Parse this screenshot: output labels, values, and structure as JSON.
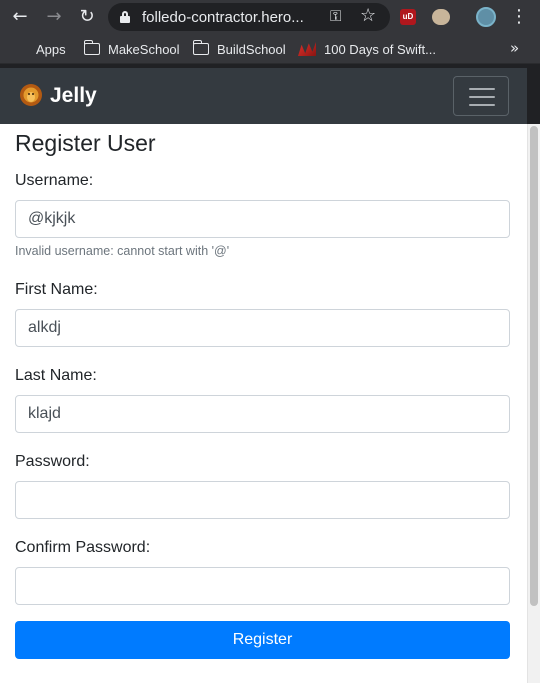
{
  "browser": {
    "url": "folledo-contractor.hero...",
    "bookmarks": [
      {
        "label": "Apps"
      },
      {
        "label": "MakeSchool"
      },
      {
        "label": "BuildSchool"
      },
      {
        "label": "100 Days of Swift..."
      }
    ],
    "more_bookmarks": "»",
    "extension_ublock": "uD"
  },
  "navbar": {
    "brand": "Jelly"
  },
  "form": {
    "title": "Register User",
    "username_label": "Username:",
    "username_value": "@kjkjk",
    "username_error": "Invalid username: cannot start with '@'",
    "first_name_label": "First Name:",
    "first_name_value": "alkdj",
    "last_name_label": "Last Name:",
    "last_name_value": "klajd",
    "password_label": "Password:",
    "password_value": "",
    "confirm_password_label": "Confirm Password:",
    "confirm_password_value": "",
    "submit_label": "Register"
  },
  "colors": {
    "primary": "#007bff",
    "navbar_bg": "#343a40",
    "browser_chrome": "#35363a"
  }
}
